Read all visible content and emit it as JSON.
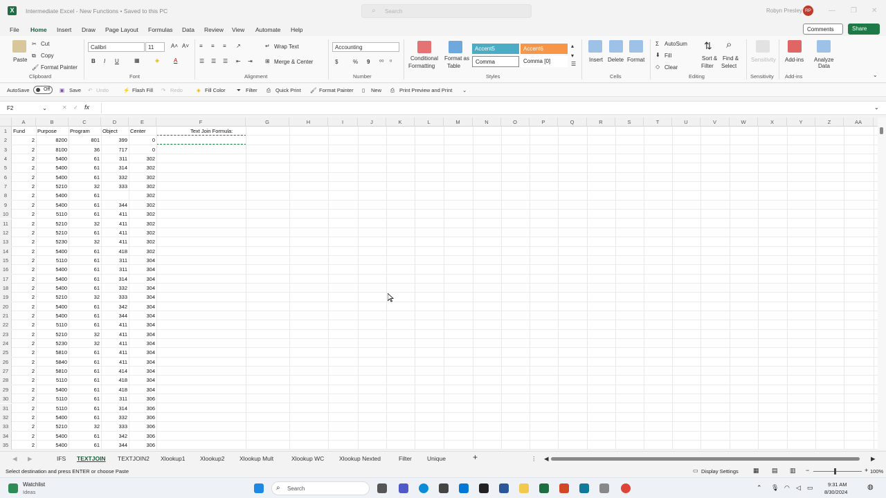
{
  "app": {
    "title": "Intermediate Excel - New Functions • Saved to this PC",
    "logo": "X"
  },
  "titlebar": {
    "search_placeholder": "Search",
    "user_name": "Robyn Presley",
    "user_initials": "RP"
  },
  "menu": {
    "tabs": [
      "File",
      "Home",
      "Insert",
      "Draw",
      "Page Layout",
      "Formulas",
      "Data",
      "Review",
      "View",
      "Automate",
      "Help"
    ],
    "active": "Home",
    "comments": "Comments",
    "share": "Share"
  },
  "ribbon": {
    "clipboard": {
      "paste": "Paste",
      "cut": "Cut",
      "copy": "Copy",
      "format_painter": "Format Painter",
      "label": "Clipboard"
    },
    "font": {
      "name": "Calibri",
      "size": "11",
      "bold": "B",
      "italic": "I",
      "underline": "U",
      "label": "Font"
    },
    "alignment": {
      "wrap": "Wrap Text",
      "merge": "Merge & Center",
      "label": "Alignment"
    },
    "number": {
      "format": "Accounting",
      "currency": "$",
      "percent": "%",
      "comma": "9",
      "label": "Number"
    },
    "styles": {
      "conditional": "Conditional",
      "formatting": "Formatting",
      "format_as": "Format as",
      "table": "Table",
      "accent5": "Accent5",
      "accent6": "Accent6",
      "comma": "Comma",
      "comma0": "Comma [0]",
      "label": "Styles"
    },
    "cells": {
      "insert": "Insert",
      "delete": "Delete",
      "format": "Format",
      "label": "Cells"
    },
    "editing": {
      "autosum": "AutoSum",
      "fill": "Fill",
      "clear": "Clear",
      "sort": "Sort &",
      "filter": "Filter",
      "find": "Find &",
      "select": "Select",
      "label": "Editing"
    },
    "sensitivity": {
      "btn": "Sensitivity",
      "label": "Sensitivity"
    },
    "addins": {
      "btn": "Add-ins",
      "label": "Add-ins"
    },
    "analyze": {
      "line1": "Analyze",
      "line2": "Data"
    }
  },
  "qat": {
    "autosave": "AutoSave",
    "autosave_state": "Off",
    "save": "Save",
    "undo": "Undo",
    "flash_fill": "Flash Fill",
    "redo": "Redo",
    "fill_color": "Fill Color",
    "filter": "Filter",
    "quick_print": "Quick Print",
    "format_painter": "Format Painter",
    "new": "New",
    "print_preview": "Print Preview and Print"
  },
  "formula_bar": {
    "name_box": "F2",
    "fx": "fx",
    "content": ""
  },
  "columns": [
    "A",
    "B",
    "C",
    "D",
    "E",
    "F",
    "G",
    "H",
    "I",
    "J",
    "K",
    "L",
    "M",
    "N",
    "O",
    "P",
    "Q",
    "R",
    "S",
    "T",
    "U",
    "V",
    "W",
    "X",
    "Y",
    "Z",
    "AA"
  ],
  "headers": [
    "Fund",
    "Purpose",
    "Program",
    "Object",
    "Center"
  ],
  "f1_text": "Text Join Formula:",
  "rows": [
    [
      "2",
      "8200",
      "801",
      "399",
      "0"
    ],
    [
      "2",
      "8100",
      "36",
      "717",
      "0"
    ],
    [
      "2",
      "5400",
      "61",
      "311",
      "302"
    ],
    [
      "2",
      "5400",
      "61",
      "314",
      "302"
    ],
    [
      "2",
      "5400",
      "61",
      "332",
      "302"
    ],
    [
      "2",
      "5210",
      "32",
      "333",
      "302"
    ],
    [
      "2",
      "5400",
      "61",
      "",
      "302"
    ],
    [
      "2",
      "5400",
      "61",
      "344",
      "302"
    ],
    [
      "2",
      "5110",
      "61",
      "411",
      "302"
    ],
    [
      "2",
      "5210",
      "32",
      "411",
      "302"
    ],
    [
      "2",
      "5210",
      "61",
      "411",
      "302"
    ],
    [
      "2",
      "5230",
      "32",
      "411",
      "302"
    ],
    [
      "2",
      "5400",
      "61",
      "418",
      "302"
    ],
    [
      "2",
      "5110",
      "61",
      "311",
      "304"
    ],
    [
      "2",
      "5400",
      "61",
      "311",
      "304"
    ],
    [
      "2",
      "5400",
      "61",
      "314",
      "304"
    ],
    [
      "2",
      "5400",
      "61",
      "332",
      "304"
    ],
    [
      "2",
      "5210",
      "32",
      "333",
      "304"
    ],
    [
      "2",
      "5400",
      "61",
      "342",
      "304"
    ],
    [
      "2",
      "5400",
      "61",
      "344",
      "304"
    ],
    [
      "2",
      "5110",
      "61",
      "411",
      "304"
    ],
    [
      "2",
      "5210",
      "32",
      "411",
      "304"
    ],
    [
      "2",
      "5230",
      "32",
      "411",
      "304"
    ],
    [
      "2",
      "5810",
      "61",
      "411",
      "304"
    ],
    [
      "2",
      "5840",
      "61",
      "411",
      "304"
    ],
    [
      "2",
      "5810",
      "61",
      "414",
      "304"
    ],
    [
      "2",
      "5110",
      "61",
      "418",
      "304"
    ],
    [
      "2",
      "5400",
      "61",
      "418",
      "304"
    ],
    [
      "2",
      "5110",
      "61",
      "311",
      "306"
    ],
    [
      "2",
      "5110",
      "61",
      "314",
      "306"
    ],
    [
      "2",
      "5400",
      "61",
      "332",
      "306"
    ],
    [
      "2",
      "5210",
      "32",
      "333",
      "306"
    ],
    [
      "2",
      "5400",
      "61",
      "342",
      "306"
    ],
    [
      "2",
      "5400",
      "61",
      "344",
      "306"
    ]
  ],
  "sheets": [
    "IFS",
    "TEXTJOIN",
    "TEXTJOIN2",
    "Xlookup1",
    "Xlookup2",
    "Xlookup Mult",
    "Xlookup WC",
    "Xlookup Nexted",
    "Filter",
    "Unique"
  ],
  "active_sheet": "TEXTJOIN",
  "status": {
    "message": "Select destination and press ENTER or choose Paste",
    "display_settings": "Display Settings",
    "zoom": "100%"
  },
  "taskbar": {
    "watchlist": "Watchlist",
    "ideas": "Ideas",
    "search": "Search",
    "time": "9:31 AM",
    "date": "8/30/2024"
  },
  "colors": {
    "excel_green": "#185c37",
    "accent5": "#4bacc6",
    "accent6": "#f79646"
  }
}
